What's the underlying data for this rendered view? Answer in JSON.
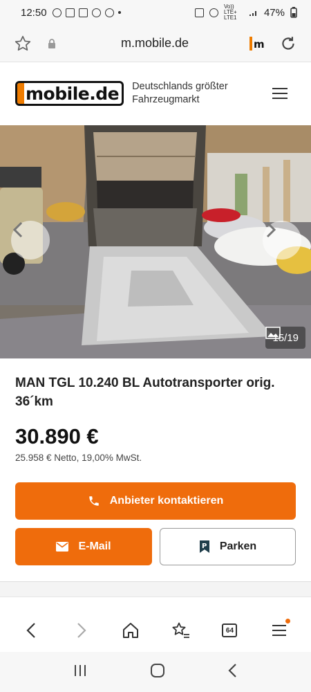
{
  "status": {
    "time": "12:50",
    "network": "Vo)) LTE+ LTE1",
    "battery": "47%"
  },
  "browser": {
    "url": "m.mobile.de",
    "tab_count": "64"
  },
  "site": {
    "logo_text": "mobile.de",
    "tagline": "Deutschlands größter Fahrzeugmarkt"
  },
  "gallery": {
    "counter": "15/19"
  },
  "listing": {
    "title": "MAN TGL 10.240 BL Autotransporter orig. 36´km",
    "price": "30.890 €",
    "net_price": "25.958 € Netto, 19,00% MwSt."
  },
  "actions": {
    "contact_label": "Anbieter kontaktieren",
    "email_label": "E-Mail",
    "park_label": "Parken"
  },
  "colors": {
    "accent": "#ef6c0c",
    "brand_orange": "#ef7c00"
  },
  "icons": {
    "bookmark": "star-icon",
    "secure": "lock-icon",
    "reload": "reload-icon",
    "menu": "hamburger-icon",
    "phone": "phone-icon",
    "mail": "mail-icon",
    "parking": "parking-icon",
    "back": "chevron-left-icon",
    "forward": "chevron-right-icon",
    "home": "home-icon",
    "bookmarks": "star-list-icon",
    "tabs": "tabs-icon",
    "more": "menu-icon"
  }
}
